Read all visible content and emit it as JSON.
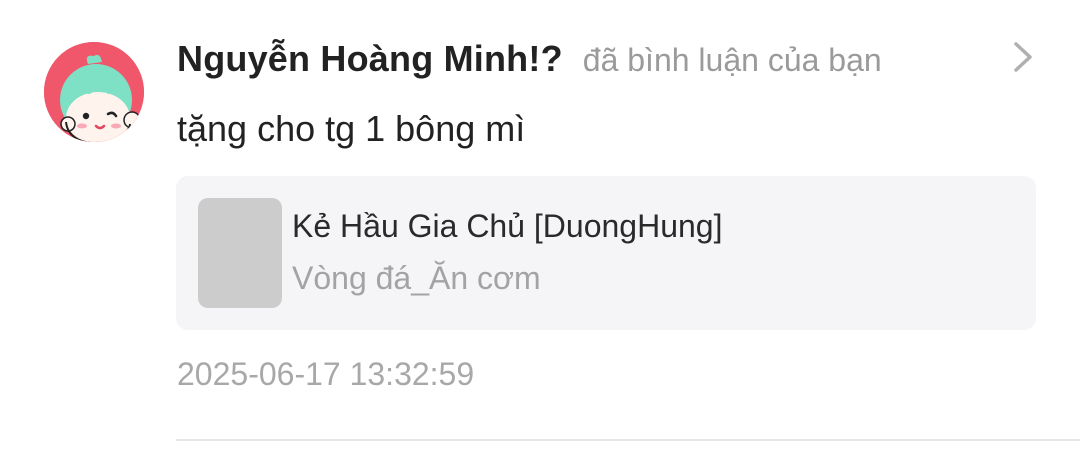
{
  "notification": {
    "user": {
      "name": "Nguyễn Hoàng Minh!?",
      "avatar_icon": "cartoon-face-avatar"
    },
    "action_text": "đã bình luận của bạn",
    "comment": "tặng cho tg 1 bông mì",
    "book": {
      "title": "Kẻ Hầu Gia Chủ [DuongHung]",
      "chapter": "Vòng đá_Ăn cơm"
    },
    "timestamp": "2025-06-17 13:32:59",
    "colors": {
      "avatar_bg": "#f0576b",
      "avatar_hair": "#7ee0c4",
      "name_text": "#222222",
      "secondary_text": "#9a9a9a",
      "card_bg": "#f5f5f7"
    }
  }
}
